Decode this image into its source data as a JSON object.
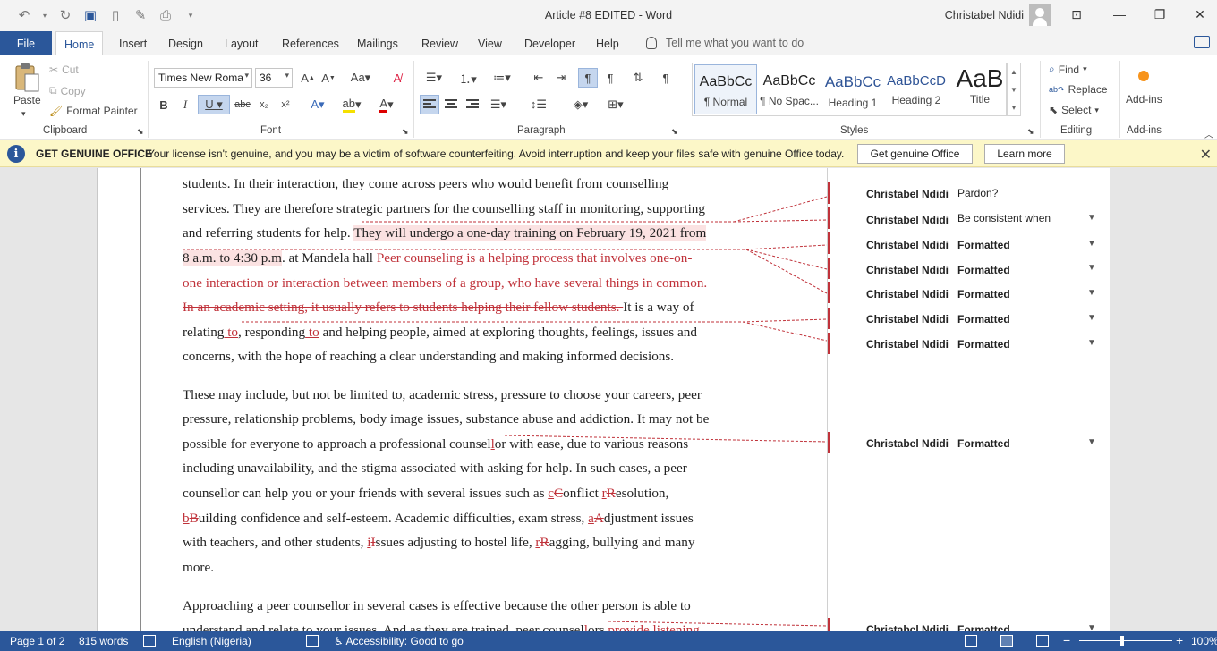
{
  "window": {
    "title": "Article #8 EDITED  -  Word",
    "user": "Christabel Ndidi"
  },
  "tabs": [
    "File",
    "Home",
    "Insert",
    "Design",
    "Layout",
    "References",
    "Mailings",
    "Review",
    "View",
    "Developer",
    "Help"
  ],
  "tell_me": "Tell me what you want to do",
  "ribbon": {
    "clipboard": {
      "paste": "Paste",
      "cut": "Cut",
      "copy": "Copy",
      "format_painter": "Format Painter",
      "label": "Clipboard"
    },
    "font": {
      "name": "Times New Roma",
      "size": "36",
      "label": "Font"
    },
    "paragraph": {
      "label": "Paragraph"
    },
    "styles": {
      "items": [
        {
          "preview": "AaBbCc",
          "name": "¶ Normal"
        },
        {
          "preview": "AaBbCc",
          "name": "¶ No Spac..."
        },
        {
          "preview": "AaBbCc",
          "name": "Heading 1"
        },
        {
          "preview": "AaBbCcD",
          "name": "Heading 2"
        },
        {
          "preview": "AaB",
          "name": "Title"
        }
      ],
      "label": "Styles"
    },
    "editing": {
      "find": "Find",
      "replace": "Replace",
      "select": "Select",
      "label": "Editing"
    },
    "addins": {
      "button": "Add-ins",
      "label": "Add-ins"
    }
  },
  "infobar": {
    "title": "GET GENUINE OFFICE",
    "message": "Your license isn't genuine, and you may be a victim of software counterfeiting. Avoid interruption and keep your files safe with genuine Office today.",
    "button_genuine": "Get genuine Office",
    "button_learn": "Learn more"
  },
  "document": {
    "p1": [
      "students. In their interaction, they come across peers who would benefit from counselling",
      "services. They are therefore strategic partners for the counselling staff in monitoring, supporting",
      "and referring students for help. ",
      "They will undergo a one-day training on February 19, 2021 from",
      "8 a.m. to 4:30 p.m",
      ". at Mandela hall",
      "Peer counseling is a helping process that involves one-on-",
      "one interaction or interaction between members of a group, who have several things in common.",
      "In an academic setting, it usually refers to students helping their fellow students. ",
      "It is a way of",
      "relating",
      " to",
      ", responding",
      " to",
      " and helping people, aimed at exploring thoughts, feelings, issues and",
      "concerns, with the hope of reaching a clear understanding and making informed decisions."
    ],
    "p2": [
      "These may include, but not be limited to, academic stress, pressure to choose your careers, peer",
      "pressure, relationship problems, body image issues, substance abuse and addiction. It may not be",
      "possible for everyone to approach a professional counsel",
      "l",
      "or with ease, due to various reasons",
      "including unavailability, and the stigma associated with asking for help. In such cases, a peer",
      "counsellor can help you or your friends with several issues such as ",
      "c",
      "C",
      "onflict ",
      "r",
      "R",
      "esolution,",
      "b",
      "B",
      "uilding confidence and self-esteem. Academic difficulties, exam stress, ",
      "a",
      "A",
      "djustment issues",
      "with teachers, and other students, ",
      "i",
      "I",
      "ssues adjusting to hostel life, ",
      "r",
      "R",
      "agging, bullying and many",
      "more."
    ],
    "p3": [
      "Approaching a peer counsellor in several cases is effective because the other person is able to",
      "understand and relate to your issues. And as they are trained, peer counsel",
      "l",
      "ors ",
      "provide",
      " listening"
    ]
  },
  "comments": [
    {
      "author": "Christabel Ndidi",
      "text": "Pardon?"
    },
    {
      "author": "Christabel Ndidi",
      "text": "Be consistent when"
    },
    {
      "author": "Christabel Ndidi",
      "text": "Formatted"
    },
    {
      "author": "Christabel Ndidi",
      "text": "Formatted"
    },
    {
      "author": "Christabel Ndidi",
      "text": "Formatted"
    },
    {
      "author": "Christabel Ndidi",
      "text": "Formatted"
    },
    {
      "author": "Christabel Ndidi",
      "text": "Formatted"
    },
    {
      "author": "Christabel Ndidi",
      "text": "Formatted"
    },
    {
      "author": "Christabel Ndidi",
      "text": "Formatted"
    }
  ],
  "status": {
    "page": "Page 1 of 2",
    "words": "815 words",
    "language": "English (Nigeria)",
    "accessibility": "Accessibility: Good to go",
    "zoom": "100%"
  },
  "colors": {
    "accent": "#2b579a",
    "revision": "#c0323a",
    "infobar": "#fcf7c8"
  }
}
